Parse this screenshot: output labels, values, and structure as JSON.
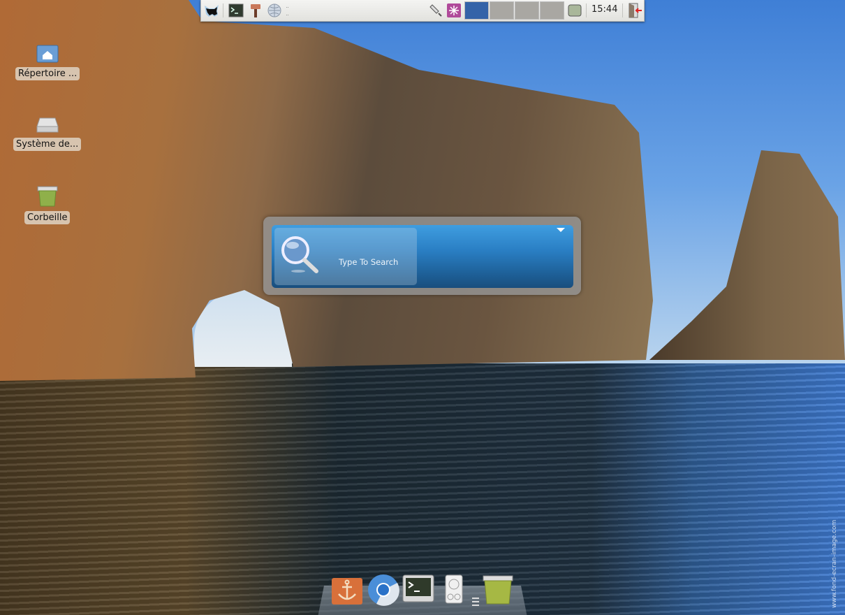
{
  "panel": {
    "launchers": [
      {
        "name": "xfce-menu",
        "icon": "mouse-logo-icon"
      },
      {
        "name": "terminal",
        "icon": "terminal-icon"
      },
      {
        "name": "settings",
        "icon": "paintbrush-icon"
      },
      {
        "name": "browser",
        "icon": "globe-icon"
      }
    ],
    "tray": [
      {
        "icon": "network-icon"
      },
      {
        "icon": "notification-icon"
      }
    ],
    "workspaces": [
      {
        "active": true
      },
      {
        "active": false
      },
      {
        "active": false
      },
      {
        "active": false
      }
    ],
    "workspace_active_color": "#3463a8",
    "clock": "15:44",
    "logout_icon": "logout-icon"
  },
  "desktop": {
    "icons": [
      {
        "label": "Répertoire ...",
        "icon": "home-folder-icon"
      },
      {
        "label": "Système de...",
        "icon": "drive-icon"
      },
      {
        "label": "Corbeille",
        "icon": "trash-icon"
      }
    ]
  },
  "search": {
    "placeholder": "Type To Search",
    "accent": "#2a7fc4"
  },
  "dock": {
    "items": [
      {
        "name": "anchor",
        "icon": "anchor-icon"
      },
      {
        "name": "chromium",
        "icon": "chromium-icon"
      },
      {
        "name": "terminal",
        "icon": "terminal-icon"
      },
      {
        "name": "disk",
        "icon": "harddisk-icon"
      },
      {
        "name": "trash",
        "icon": "trash-icon"
      }
    ]
  },
  "watermark": "www.fond-ecran-image.com"
}
